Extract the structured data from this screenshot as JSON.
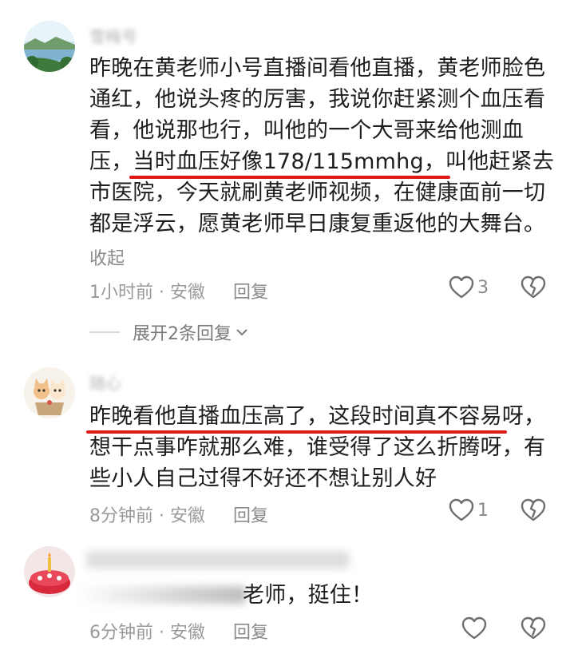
{
  "comments": [
    {
      "name": "雪梅号",
      "text_lines": [
        "昨晚在黄老师小号直播间看他直播，黄老师脸色",
        "通红，他说头疼的厉害，我说你赶紧测个血压看",
        "看，他说那也行，叫他的一个大哥来给他测血"
      ],
      "line4_pre": "压，",
      "line4_highlight": "当时血压好像178/115mmhg，",
      "line4_post": "叫他赶紧去",
      "text_tail": [
        "市医院，今天就刷黄老师视频，在健康面前一切",
        "都是浮云，愿黄老师早日康复重返他的大舞台。"
      ],
      "collapse": "收起",
      "time": "1小时前",
      "location": "安徽",
      "reply": "回复",
      "likes": "3",
      "expand": "展开2条回复"
    },
    {
      "name": "随心",
      "line1_highlight": "昨晚看他直播血压高了，这段时间真不容易",
      "line1_post": "呀，",
      "text_tail": [
        "想干点事咋就那么难，谁受得了这么折腾呀，有",
        "些小人自己过得不好还不想让别人好"
      ],
      "time": "8分钟前",
      "location": "安徽",
      "reply": "回复",
      "likes": "1"
    },
    {
      "text": "老师，挺住！",
      "time": "6分钟前",
      "location": "安徽",
      "reply": "回复"
    }
  ],
  "separator": "·",
  "colors": {
    "highlight_underline": "#e01818",
    "meta": "#9a9a9a"
  },
  "icons": [
    "heart-icon",
    "broken-heart-icon",
    "chevron-down-icon"
  ]
}
